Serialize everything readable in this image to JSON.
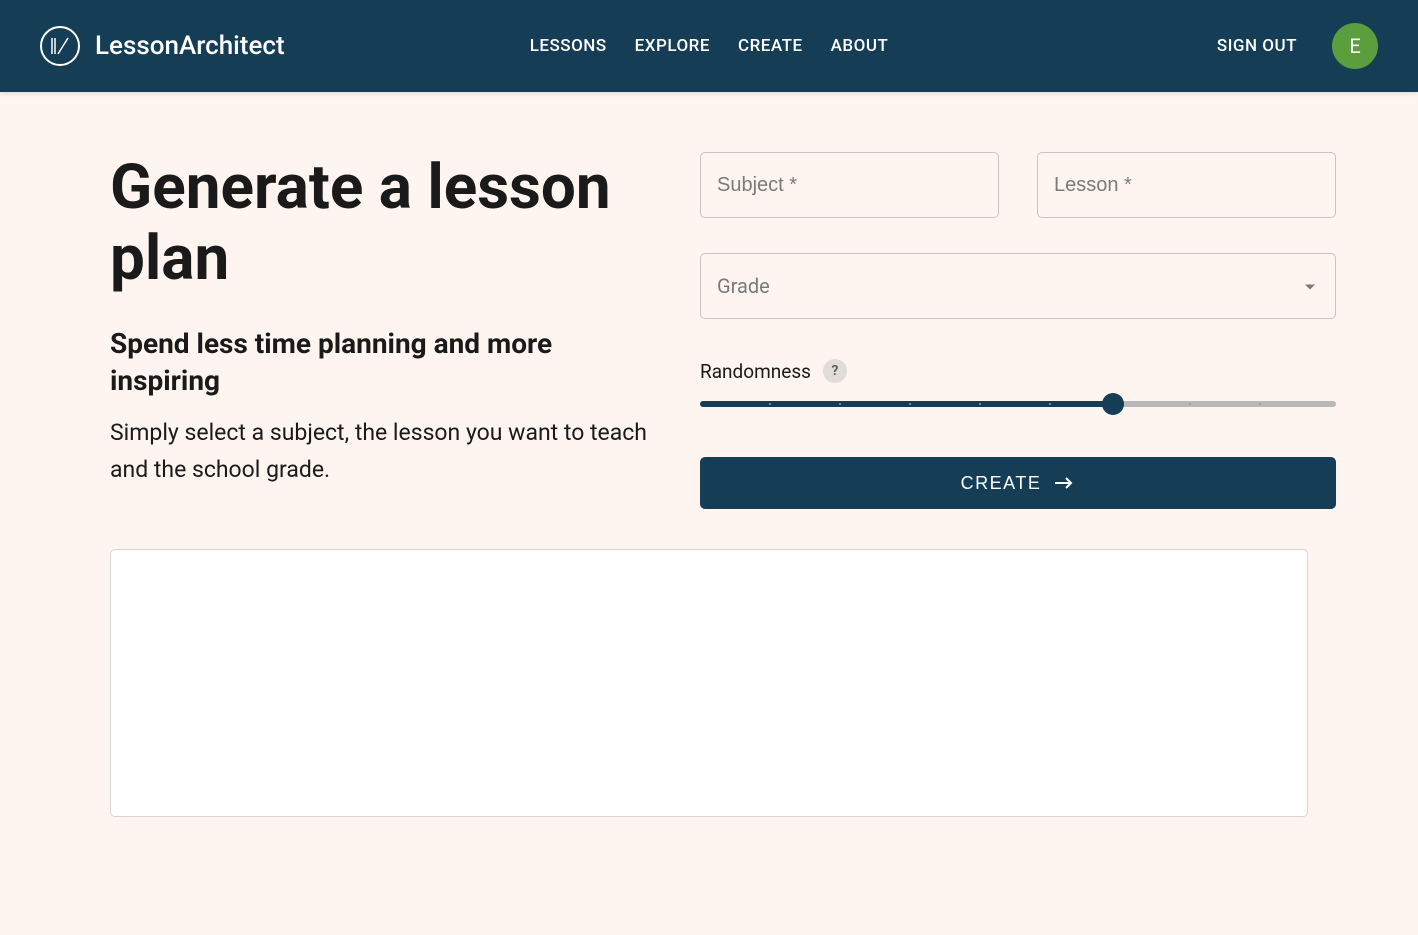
{
  "header": {
    "brand": "LessonArchitect",
    "nav": {
      "lessons": "LESSONS",
      "explore": "EXPLORE",
      "create": "CREATE",
      "about": "ABOUT"
    },
    "sign_out": "SIGN OUT",
    "avatar_initial": "E"
  },
  "main": {
    "title": "Generate a lesson plan",
    "subtitle": "Spend less time planning and more inspiring",
    "description": "Simply select a subject, the lesson you want to teach and the school grade."
  },
  "form": {
    "subject_placeholder": "Subject *",
    "lesson_placeholder": "Lesson *",
    "grade_label": "Grade",
    "randomness_label": "Randomness",
    "help_symbol": "?",
    "create_button": "CREATE",
    "slider_value": 65
  }
}
